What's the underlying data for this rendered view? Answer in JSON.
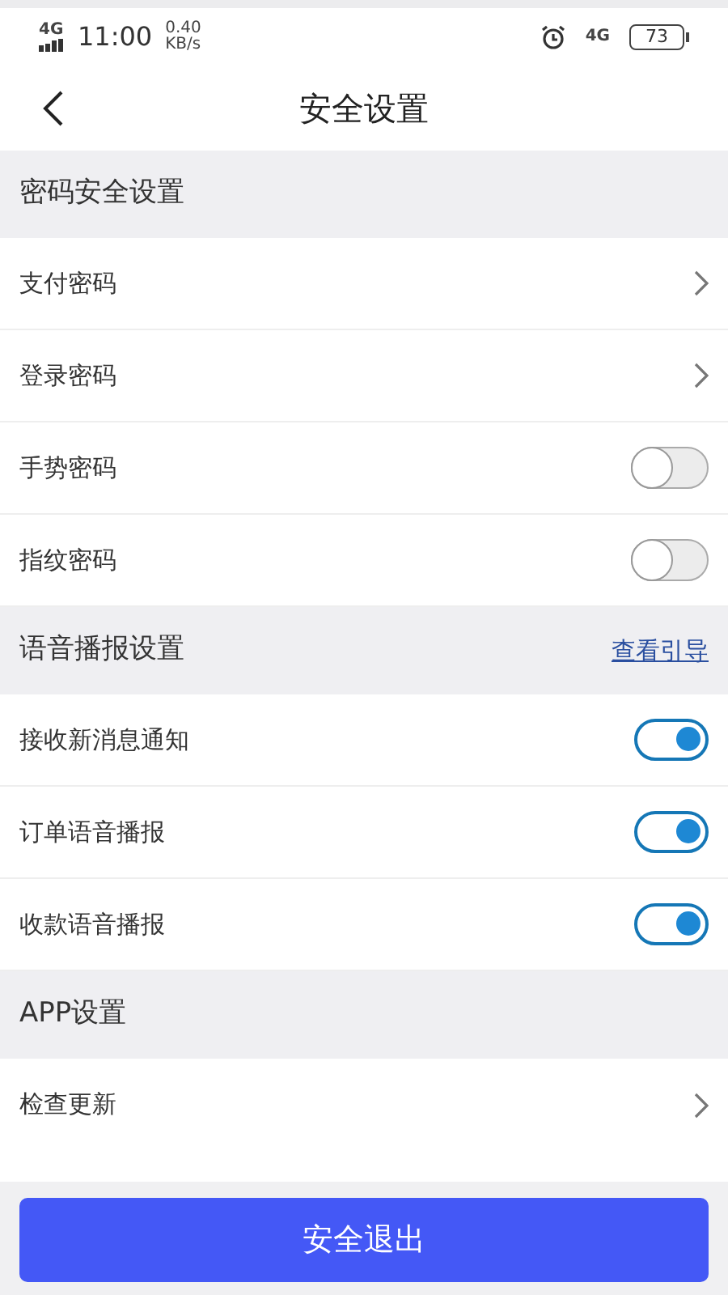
{
  "status_bar": {
    "network_left": "4G",
    "time": "11:00",
    "speed": "0.40",
    "speed_unit": "KB/s",
    "network_right": "4G",
    "battery": "73"
  },
  "header": {
    "title": "安全设置"
  },
  "sections": [
    {
      "title": "密码安全设置",
      "rows": [
        {
          "label": "支付密码",
          "kind": "link"
        },
        {
          "label": "登录密码",
          "kind": "link"
        },
        {
          "label": "手势密码",
          "kind": "toggle",
          "on": false
        },
        {
          "label": "指纹密码",
          "kind": "toggle",
          "on": false
        }
      ]
    },
    {
      "title": "语音播报设置",
      "link": "查看引导",
      "rows": [
        {
          "label": "接收新消息通知",
          "kind": "toggle",
          "on": true
        },
        {
          "label": "订单语音播报",
          "kind": "toggle",
          "on": true
        },
        {
          "label": "收款语音播报",
          "kind": "toggle",
          "on": true
        }
      ]
    },
    {
      "title": "APP设置",
      "rows": [
        {
          "label": "检查更新",
          "kind": "link"
        }
      ]
    }
  ],
  "logout_button": "安全退出"
}
